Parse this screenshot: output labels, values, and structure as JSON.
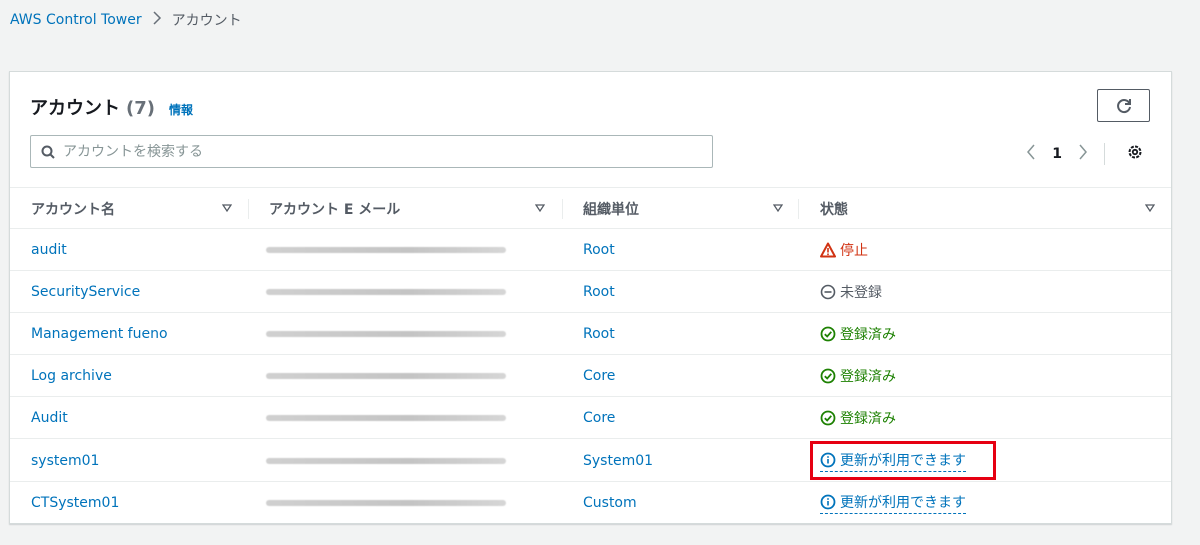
{
  "breadcrumb": {
    "root": "AWS Control Tower",
    "current": "アカウント"
  },
  "panel": {
    "title": "アカウント",
    "count": "(7)",
    "info_link": "情報"
  },
  "search": {
    "placeholder": "アカウントを検索する",
    "value": ""
  },
  "pagination": {
    "current_page": "1"
  },
  "table": {
    "columns": [
      "アカウント名",
      "アカウント E メール",
      "組織単位",
      "状態"
    ],
    "rows": [
      {
        "name": "audit",
        "ou": "Root",
        "status": "停止",
        "status_type": "error"
      },
      {
        "name": "SecurityService",
        "ou": "Root",
        "status": "未登録",
        "status_type": "neutral"
      },
      {
        "name": "Management fueno",
        "ou": "Root",
        "status": "登録済み",
        "status_type": "ok"
      },
      {
        "name": "Log archive",
        "ou": "Core",
        "status": "登録済み",
        "status_type": "ok"
      },
      {
        "name": "Audit",
        "ou": "Core",
        "status": "登録済み",
        "status_type": "ok"
      },
      {
        "name": "system01",
        "ou": "System01",
        "status": "更新が利用できます",
        "status_type": "info"
      },
      {
        "name": "CTSystem01",
        "ou": "Custom",
        "status": "更新が利用できます",
        "status_type": "info"
      }
    ]
  },
  "icons": {
    "refresh": "refresh-icon",
    "search": "search-icon",
    "settings": "gear-icon",
    "sort": "caret-down-icon",
    "error": "warning-icon",
    "neutral": "minus-circle-icon",
    "ok": "check-circle-icon",
    "info": "info-circle-icon"
  },
  "colors": {
    "link": "#0073bb",
    "error": "#d13212",
    "ok": "#1d8102",
    "neutral": "#545b64",
    "highlight": "#e60012"
  }
}
